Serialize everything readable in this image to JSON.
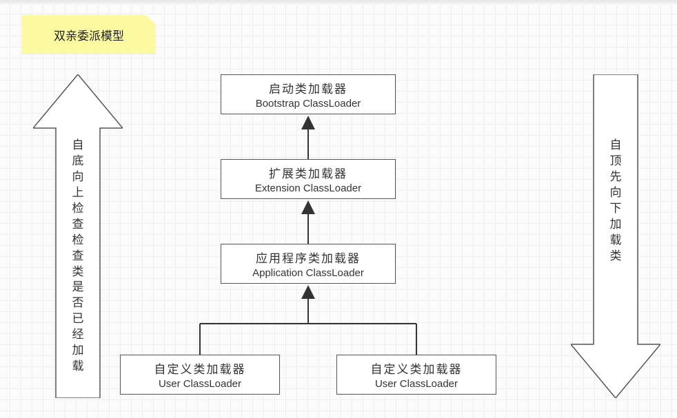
{
  "title": "双亲委派模型",
  "left_arrow_label": "自底向上检查检查类是否已经加载",
  "right_arrow_label": "自顶先向下加载类",
  "boxes": {
    "bootstrap": {
      "cn": "启动类加载器",
      "en": "Bootstrap ClassLoader"
    },
    "extension": {
      "cn": "扩展类加载器",
      "en": "Extension ClassLoader"
    },
    "application": {
      "cn": "应用程序类加载器",
      "en": "Application ClassLoader"
    },
    "user_left": {
      "cn": "自定义类加载器",
      "en": "User ClassLoader"
    },
    "user_right": {
      "cn": "自定义类加载器",
      "en": "User ClassLoader"
    }
  },
  "colors": {
    "sticky_bg": "#fbfaa0",
    "box_border": "#555555",
    "grid_major": "#dddddd",
    "grid_minor": "#eeeeee"
  }
}
